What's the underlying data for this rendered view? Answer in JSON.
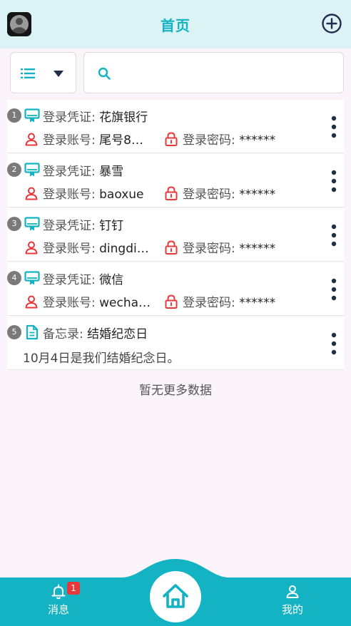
{
  "header": {
    "title": "首页"
  },
  "search": {
    "placeholder": "",
    "value": ""
  },
  "items": [
    {
      "index": "1",
      "type": "credential",
      "label": "登录凭证:",
      "name": "花旗银行",
      "account_label": "登录账号:",
      "account": "尾号8…",
      "password_label": "登录密码:",
      "password": "******"
    },
    {
      "index": "2",
      "type": "credential",
      "label": "登录凭证:",
      "name": "暴雪",
      "account_label": "登录账号:",
      "account": "baoxue",
      "password_label": "登录密码:",
      "password": "******"
    },
    {
      "index": "3",
      "type": "credential",
      "label": "登录凭证:",
      "name": "钉钉",
      "account_label": "登录账号:",
      "account": "dingdi…",
      "password_label": "登录密码:",
      "password": "******"
    },
    {
      "index": "4",
      "type": "credential",
      "label": "登录凭证:",
      "name": "微信",
      "account_label": "登录账号:",
      "account": "wecha…",
      "password_label": "登录密码:",
      "password": "******"
    },
    {
      "index": "5",
      "type": "memo",
      "label": "备忘录:",
      "name": "结婚纪恋日",
      "memo": "10月4日是我们结婚纪念日。"
    }
  ],
  "footer_note": "暂无更多数据",
  "tabbar": {
    "messages_label": "消息",
    "messages_badge": "1",
    "mine_label": "我的"
  },
  "colors": {
    "accent": "#13b3c4",
    "header_bg": "#dcf3f6",
    "danger": "#e8383c",
    "navy": "#1f2d4f"
  }
}
